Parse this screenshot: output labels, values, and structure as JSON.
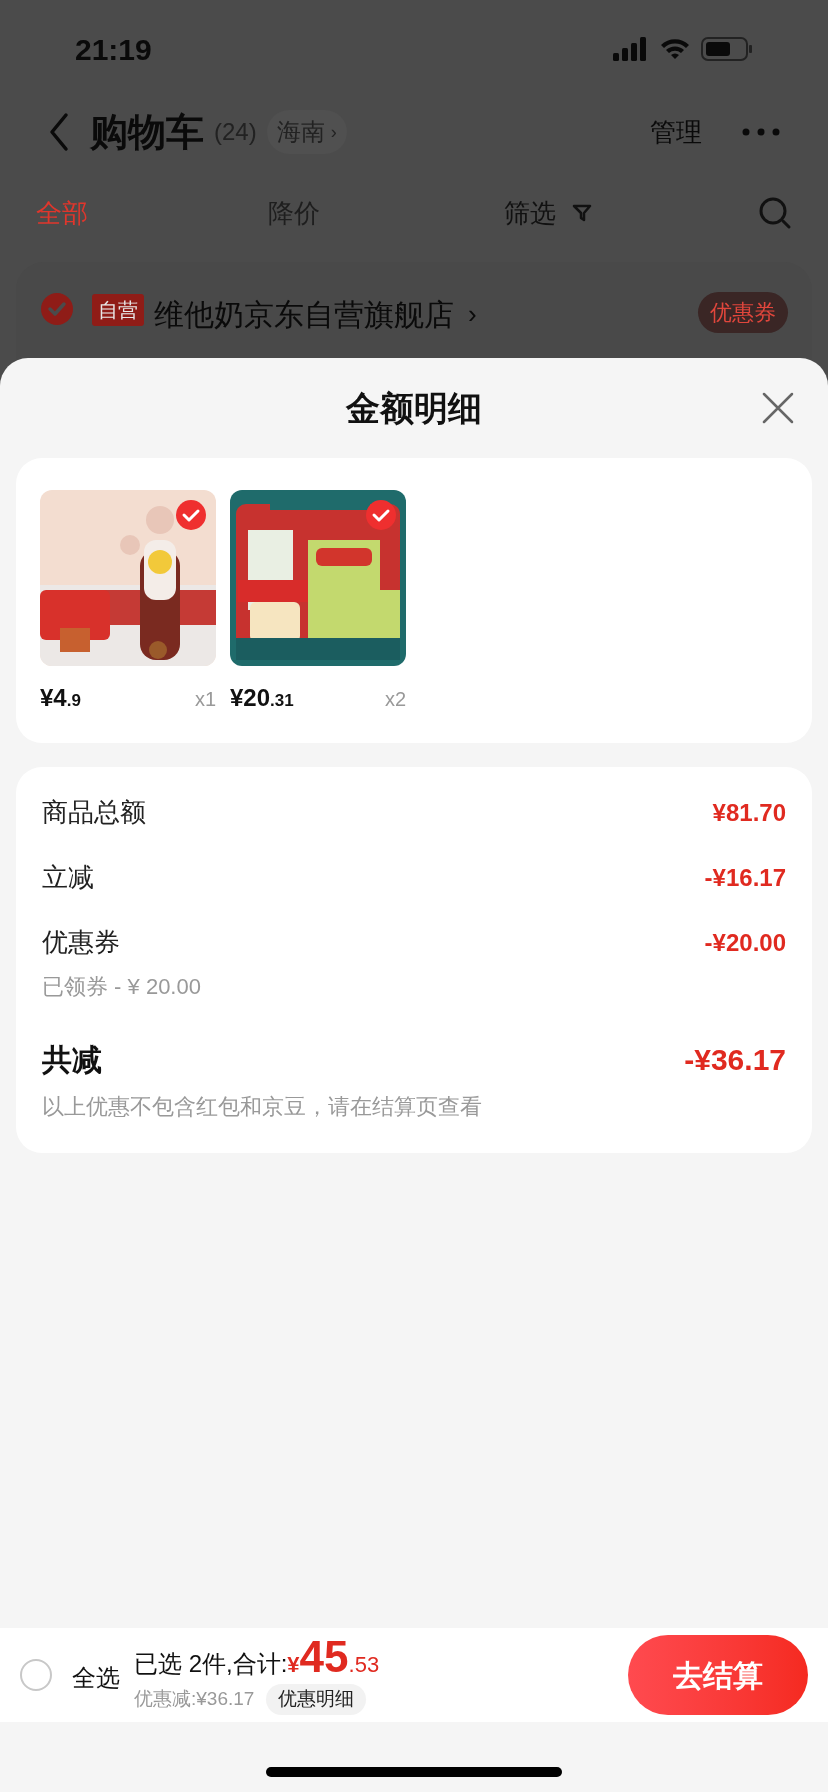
{
  "status_bar": {
    "time": "21:19"
  },
  "header": {
    "title": "购物车",
    "count": "(24)",
    "region": "海南",
    "region_arrow": "›",
    "manage": "管理"
  },
  "tabs": [
    {
      "label": "全部",
      "selected": true
    },
    {
      "label": "降价",
      "selected": false
    }
  ],
  "filter": {
    "label": "筛选"
  },
  "store": {
    "checked": true,
    "tag": "自营",
    "name": "维他奶京东自营旗舰店",
    "arrow": "›",
    "coupon": "优惠券"
  },
  "sheet": {
    "title": "金额明细",
    "products": [
      {
        "checked": true,
        "price": "¥4",
        "price_decimal": ".9",
        "quantity": "x1",
        "kind": "picture"
      },
      {
        "checked": true,
        "price": "¥20",
        "price_decimal": ".31",
        "quantity": "x2",
        "kind": "picture"
      }
    ],
    "lines": [
      {
        "kind": "normal",
        "label": "商品总额",
        "amount": "¥81.70"
      },
      {
        "kind": "normal",
        "label": "立减",
        "amount": "-¥16.17"
      },
      {
        "kind": "normal",
        "label": "优惠券",
        "amount": "-¥20.00",
        "note": "已领券 - ¥ 20.00"
      },
      {
        "kind": "total",
        "label": "共减",
        "amount": "-¥36.17",
        "note": "以上优惠不包含红包和京豆，请在结算页查看"
      }
    ]
  },
  "bottom_bar": {
    "select_all": {
      "label": "全选",
      "checked": false
    },
    "summary": "已选 2件,合计:",
    "total_symbol": "¥",
    "total_int": "45",
    "total_decimal": ".53",
    "discount": "优惠减:¥36.17",
    "detail_button": "优惠明细",
    "checkout": "去结算"
  }
}
